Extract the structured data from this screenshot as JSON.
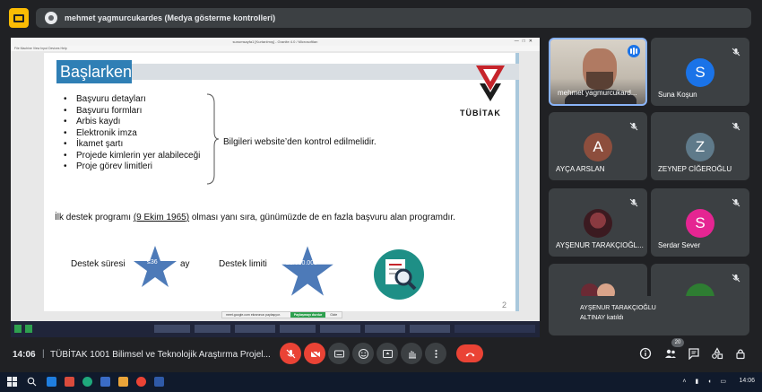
{
  "presenter": {
    "name": "mehmet yagmurcukardes (Medya gösterme kontrolleri)"
  },
  "shared_screen": {
    "window_title": "sunumsayfa1 [Kurtarılmış] - Granite 4.0 / Microsoftları",
    "menu": "File   Machine   View   Input   Devices   Help",
    "slide": {
      "heading": "Başlarken",
      "bullets": [
        "Başvuru detayları",
        "Başvuru formları",
        "Arbis kaydı",
        "Elektronik imza",
        "İkamet şartı",
        "Projede kimlerin yer alabileceği",
        "Proje görev limitleri"
      ],
      "check_note": "Bilgileri website’den kontrol edilmelidir.",
      "program_before": "İlk destek programı ",
      "program_date": "(9 Ekim 1965)",
      "program_after": " olması yanı sıra, günümüzde de en fazla başvuru alan programdır.",
      "duration_label": "Destek süresi",
      "duration_value": "≤36",
      "duration_unit": "ay",
      "limit_label": "Destek limiti",
      "limit_value": "≤1.650.000",
      "logo_text": "TÜBİTAK",
      "page_number": "2"
    },
    "notification": {
      "text": "meet.google.com ekranınızı paylaşıyor.",
      "stop_label": "Paylaşmayı durdur",
      "hide_label": "Gizle"
    }
  },
  "participants": [
    {
      "name": "mehmet yagmurcukard...",
      "type": "camera",
      "speaking": true
    },
    {
      "name": "Suna Koşun",
      "initial": "S",
      "color": "#1a73e8",
      "muted": true
    },
    {
      "name": "AYÇA ARSLAN",
      "initial": "A",
      "color": "#8d4e3d",
      "muted": true
    },
    {
      "name": "ZEYNEP CİĞEROĞLU",
      "initial": "Z",
      "color": "#5f7a8a",
      "muted": true
    },
    {
      "name": "AYŞENUR TARAKÇIOĞL...",
      "type": "photo",
      "muted": true
    },
    {
      "name": "Serdar Sever",
      "initial": "S",
      "color": "#e52592",
      "muted": true
    }
  ],
  "join_toast": {
    "line1": "AYŞENUR TARAKÇIOĞLU",
    "line2": "ALTINAY katıldı"
  },
  "bottom_bar": {
    "time": "14:06",
    "separator": "|",
    "meeting_title": "TÜBİTAK 1001 Bilimsel ve Teknolojik Araştırma Projel...",
    "people_count": "20"
  },
  "taskbar": {
    "clock": "14:06"
  },
  "colors": {
    "danger": "#ea4335",
    "accent": "#8ab4f8",
    "present": "#fbbc04"
  }
}
